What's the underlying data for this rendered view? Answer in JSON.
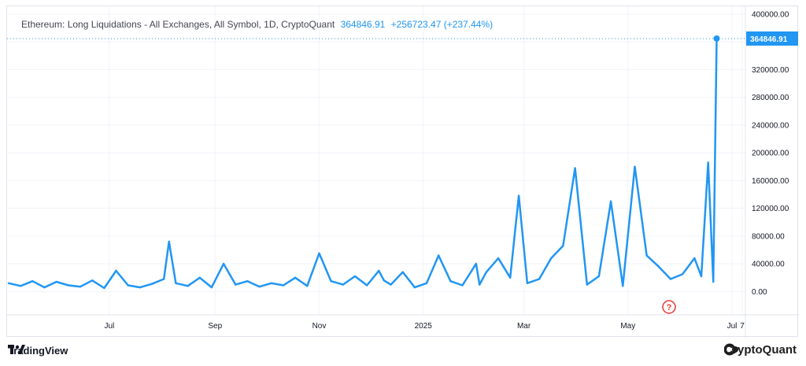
{
  "legend": {
    "title": "Ethereum: Long Liquidations - All Exchanges, All Symbol, 1D, CryptoQuant",
    "last_value": "364846.91",
    "change": "+256723.47 (+237.44%)"
  },
  "colors": {
    "line": "#2196f3",
    "grid": "#f0f3fa",
    "axis_text": "#131722",
    "badge": "#2196f3",
    "question_mark": "#e53935"
  },
  "footer": {
    "left_brand": "TradingView",
    "left_icon": "tradingview-logo-icon",
    "right_brand": "CryptoQuant",
    "right_icon": "cryptoquant-logo-icon"
  },
  "question_icon": {
    "glyph": "?"
  },
  "chart_data": {
    "type": "line",
    "title": "Ethereum: Long Liquidations - All Exchanges, All Symbol, 1D, CryptoQuant",
    "series_name": "Long Liquidations",
    "ylim": [
      -20000,
      400000
    ],
    "y_ticks": [
      "400000.00",
      "360000.00",
      "320000.00",
      "280000.00",
      "240000.00",
      "200000.00",
      "160000.00",
      "120000.00",
      "80000.00",
      "40000.00",
      "0.00"
    ],
    "x_ticks": [
      "Jul",
      "Sep",
      "Nov",
      "2025",
      "Mar",
      "May",
      "Jul",
      "7"
    ],
    "last_value_label": "364846.91",
    "x": [
      "2024-05-03",
      "2024-05-10",
      "2024-05-17",
      "2024-05-24",
      "2024-05-31",
      "2024-06-07",
      "2024-06-14",
      "2024-06-21",
      "2024-06-28",
      "2024-07-05",
      "2024-07-12",
      "2024-07-19",
      "2024-07-26",
      "2024-08-02",
      "2024-08-05",
      "2024-08-09",
      "2024-08-16",
      "2024-08-23",
      "2024-08-30",
      "2024-09-06",
      "2024-09-13",
      "2024-09-20",
      "2024-09-27",
      "2024-10-04",
      "2024-10-11",
      "2024-10-18",
      "2024-10-25",
      "2024-11-01",
      "2024-11-08",
      "2024-11-15",
      "2024-11-22",
      "2024-11-29",
      "2024-12-06",
      "2024-12-09",
      "2024-12-13",
      "2024-12-20",
      "2024-12-27",
      "2025-01-03",
      "2025-01-10",
      "2025-01-17",
      "2025-01-24",
      "2025-02-01",
      "2025-02-03",
      "2025-02-07",
      "2025-02-14",
      "2025-02-21",
      "2025-02-26",
      "2025-03-03",
      "2025-03-10",
      "2025-03-17",
      "2025-03-24",
      "2025-03-31",
      "2025-04-07",
      "2025-04-14",
      "2025-04-21",
      "2025-04-28",
      "2025-05-05",
      "2025-05-12",
      "2025-05-19",
      "2025-05-26",
      "2025-06-02",
      "2025-06-09",
      "2025-06-13",
      "2025-06-17",
      "2025-06-20",
      "2025-06-22"
    ],
    "y": [
      12000,
      8000,
      15000,
      6000,
      14000,
      9000,
      7000,
      16000,
      5000,
      30000,
      9000,
      6000,
      11000,
      18000,
      72000,
      12000,
      8000,
      20000,
      6000,
      40000,
      10000,
      15000,
      7000,
      12000,
      9000,
      20000,
      8000,
      55000,
      15000,
      10000,
      22000,
      9000,
      30000,
      16000,
      10000,
      28000,
      6000,
      12000,
      52000,
      15000,
      9000,
      40000,
      10000,
      28000,
      48000,
      20000,
      138000,
      12000,
      18000,
      48000,
      66000,
      178000,
      10000,
      22000,
      130000,
      8000,
      180000,
      52000,
      36000,
      18000,
      25000,
      48000,
      22000,
      186000,
      14000,
      364846.91
    ]
  }
}
